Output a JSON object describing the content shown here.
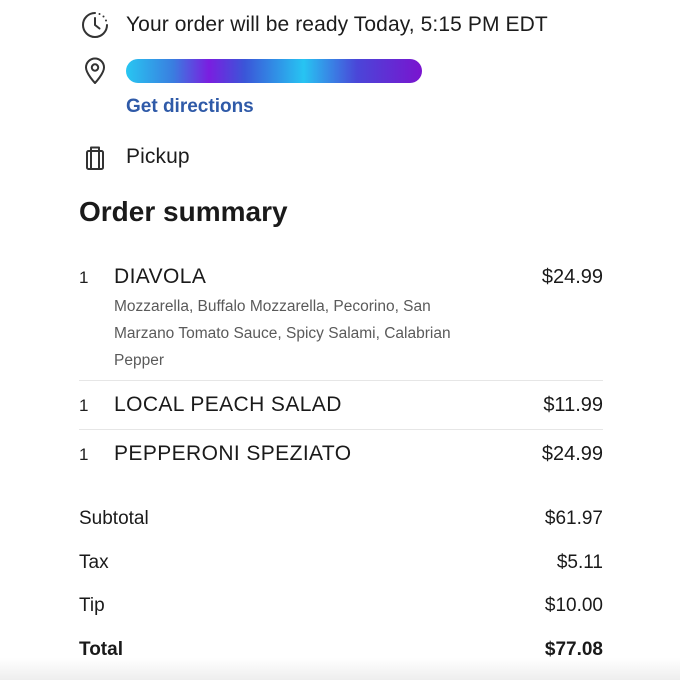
{
  "order_info": {
    "ready_text": "Your order will be ready Today, 5:15 PM EDT",
    "directions_label": "Get directions",
    "pickup_label": "Pickup",
    "icons": {
      "ready": "clock-icon",
      "address": "location-pin-icon",
      "pickup": "shopping-bag-icon"
    }
  },
  "summary": {
    "title": "Order summary",
    "items": [
      {
        "qty": "1",
        "name": "DIAVOLA",
        "price": "$24.99",
        "description": "Mozzarella, Buffalo Mozzarella, Pecorino, San Marzano Tomato Sauce, Spicy Salami, Calabrian Pepper"
      },
      {
        "qty": "1",
        "name": "LOCAL PEACH SALAD",
        "price": "$11.99",
        "description": ""
      },
      {
        "qty": "1",
        "name": "PEPPERONI SPEZIATO",
        "price": "$24.99",
        "description": ""
      }
    ]
  },
  "totals": [
    {
      "label": "Subtotal",
      "value": "$61.97"
    },
    {
      "label": "Tax",
      "value": "$5.11"
    },
    {
      "label": "Tip",
      "value": "$10.00"
    },
    {
      "label": "Total",
      "value": "$77.08"
    }
  ],
  "colors": {
    "link": "#2f5aa8",
    "text": "#1a1a1a",
    "muted": "#5a5a5a",
    "divider": "#e6e6e6"
  }
}
